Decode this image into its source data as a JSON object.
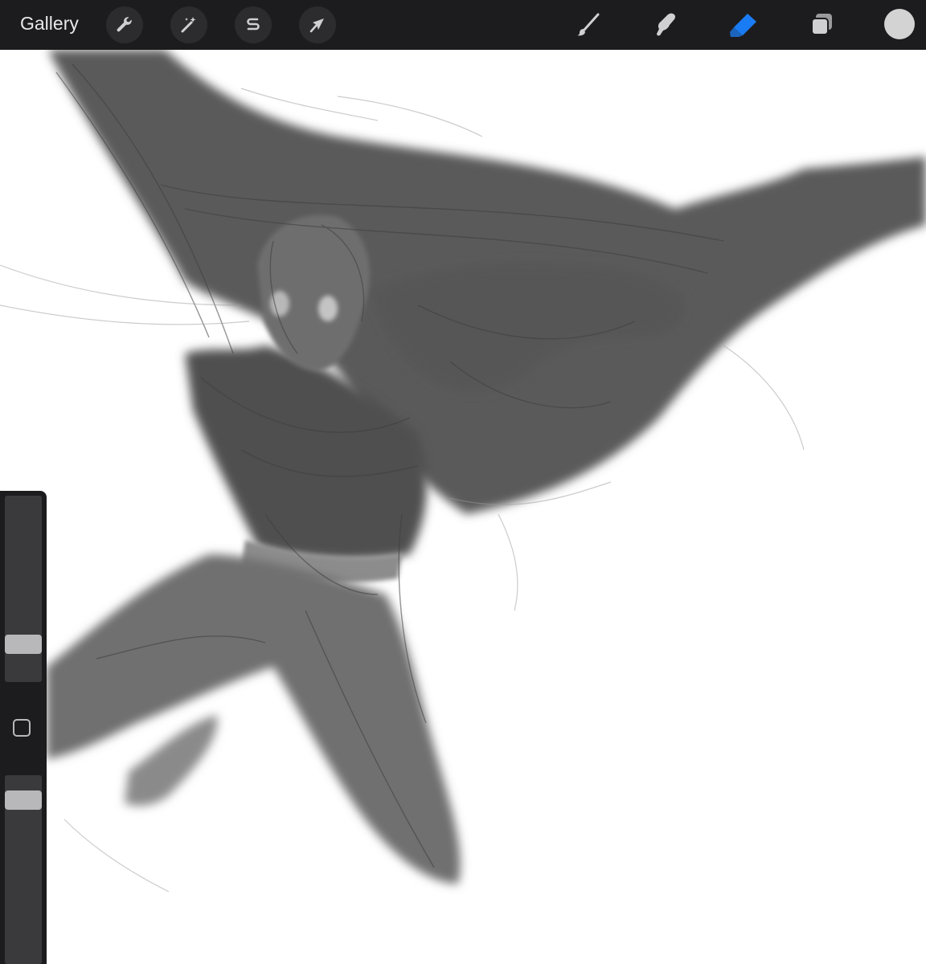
{
  "app": {
    "gallery_label": "Gallery"
  },
  "toolbar": {
    "left_tools": [
      {
        "name": "actions",
        "icon": "wrench-icon"
      },
      {
        "name": "adjustments",
        "icon": "magic-wand-icon"
      },
      {
        "name": "selection",
        "icon": "selection-s-icon"
      },
      {
        "name": "transform",
        "icon": "arrow-cursor-icon"
      }
    ],
    "right_tools": [
      {
        "name": "brush",
        "icon": "brush-icon",
        "active": false
      },
      {
        "name": "smudge",
        "icon": "smudge-finger-icon",
        "active": false
      },
      {
        "name": "eraser",
        "icon": "eraser-icon",
        "active": true
      },
      {
        "name": "layers",
        "icon": "layers-icon",
        "active": false
      }
    ],
    "current_color": "#d3d3d3",
    "active_color": "#1a7cf4"
  },
  "sidebar": {
    "brush_size_level": 0.17,
    "opacity_level": 0.91
  }
}
